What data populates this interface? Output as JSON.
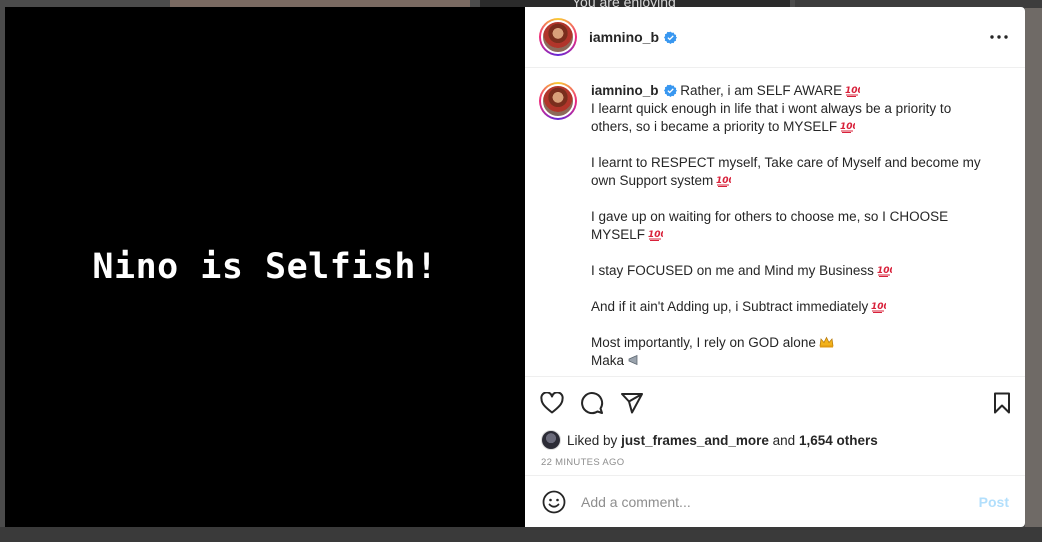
{
  "background": {
    "overlay_text": "You are enjoying"
  },
  "media": {
    "caption": "Nino is Selfish!"
  },
  "header": {
    "username": "iamnino_b",
    "more_icon": "more-horizontal-icon"
  },
  "post": {
    "username": "iamnino_b",
    "caption_first": "Rather, i am SELF AWARE",
    "caption_paragraphs": [
      "I learnt quick enough in life that i wont always be a priority to others, so i became a priority to MYSELF",
      "I learnt to RESPECT myself, Take care of Myself and become my own Support system",
      "I gave up on waiting for others to choose me, so I CHOOSE MYSELF",
      "I stay FOCUSED on me and Mind my Business",
      "And if it ain't Adding up, i Subtract immediately",
      "Most importantly, I rely on GOD alone",
      "Maka"
    ]
  },
  "likes": {
    "prefix": "Liked by",
    "liker": "just_frames_and_more",
    "conjunction": "and",
    "others": "1,654 others",
    "timestamp": "22 minutes ago"
  },
  "comment": {
    "placeholder": "Add a comment...",
    "post_label": "Post"
  },
  "colors": {
    "accent": "#0095f6",
    "post_disabled": "#b2dffc",
    "verified": "#3897f0",
    "emoji_red": "#d8213a"
  }
}
